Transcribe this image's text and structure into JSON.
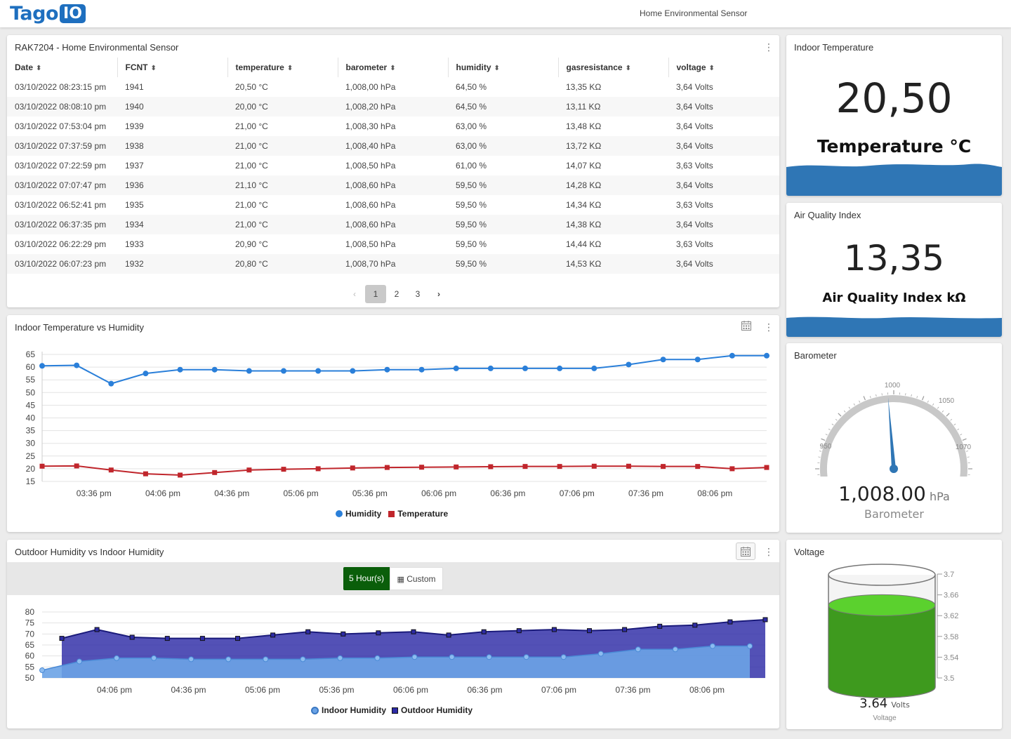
{
  "header": {
    "logo_text": "Tago",
    "logo_box": "IO",
    "dashboard_title": "Home Environmental Sensor",
    "brand_color": "#1e6fbf"
  },
  "table_widget": {
    "title": "RAK7204 - Home Environmental Sensor",
    "columns": [
      "Date",
      "FCNT",
      "temperature",
      "barometer",
      "humidity",
      "gasresistance",
      "voltage"
    ],
    "rows": [
      [
        "03/10/2022 08:23:15 pm",
        "1941",
        "20,50 °C",
        "1,008,00 hPa",
        "64,50 %",
        "13,35 KΩ",
        "3,64 Volts"
      ],
      [
        "03/10/2022 08:08:10 pm",
        "1940",
        "20,00 °C",
        "1,008,20 hPa",
        "64,50 %",
        "13,11 KΩ",
        "3,64 Volts"
      ],
      [
        "03/10/2022 07:53:04 pm",
        "1939",
        "21,00 °C",
        "1,008,30 hPa",
        "63,00 %",
        "13,48 KΩ",
        "3,64 Volts"
      ],
      [
        "03/10/2022 07:37:59 pm",
        "1938",
        "21,00 °C",
        "1,008,40 hPa",
        "63,00 %",
        "13,72 KΩ",
        "3,64 Volts"
      ],
      [
        "03/10/2022 07:22:59 pm",
        "1937",
        "21,00 °C",
        "1,008,50 hPa",
        "61,00 %",
        "14,07 KΩ",
        "3,63 Volts"
      ],
      [
        "03/10/2022 07:07:47 pm",
        "1936",
        "21,10 °C",
        "1,008,60 hPa",
        "59,50 %",
        "14,28 KΩ",
        "3,64 Volts"
      ],
      [
        "03/10/2022 06:52:41 pm",
        "1935",
        "21,00 °C",
        "1,008,60 hPa",
        "59,50 %",
        "14,34 KΩ",
        "3,63 Volts"
      ],
      [
        "03/10/2022 06:37:35 pm",
        "1934",
        "21,00 °C",
        "1,008,60 hPa",
        "59,50 %",
        "14,38 KΩ",
        "3,64 Volts"
      ],
      [
        "03/10/2022 06:22:29 pm",
        "1933",
        "20,90 °C",
        "1,008,50 hPa",
        "59,50 %",
        "14,44 KΩ",
        "3,63 Volts"
      ],
      [
        "03/10/2022 06:07:23 pm",
        "1932",
        "20,80 °C",
        "1,008,70 hPa",
        "59,50 %",
        "14,53 KΩ",
        "3,64 Volts"
      ]
    ],
    "pagination": {
      "prev": "‹",
      "pages": [
        "1",
        "2",
        "3"
      ],
      "active": "1",
      "next": "›"
    }
  },
  "indoor_temp": {
    "title": "Indoor Temperature",
    "value": "20,50",
    "label": "Temperature °C",
    "wave_color": "#2f76b5"
  },
  "air_quality": {
    "title": "Air Quality Index",
    "value": "13,35",
    "label": "Air Quality Index kΩ",
    "wave_color": "#2f76b5"
  },
  "barometer": {
    "title": "Barometer",
    "gauge_labels": [
      "950",
      "1000",
      "1050",
      "1070"
    ],
    "value_text": "1,008.00",
    "unit": "hPa",
    "caption": "Barometer",
    "needle_color": "#2f76b5",
    "alert_color": "#c9302c"
  },
  "voltage": {
    "title": "Voltage",
    "scale_labels": [
      "3.7",
      "3.66",
      "3.62",
      "3.58",
      "3.54",
      "3.5"
    ],
    "value_text": "3.64",
    "unit": "Volts",
    "caption": "Voltage",
    "fill_color": "#3e9a1e",
    "level": 3.64
  },
  "charts": {
    "temp_humidity_title": "Indoor Temperature vs Humidity",
    "outdoor_indoor_title": "Outdoor Humidity vs Indoor Humidity",
    "range_button": "5 Hour(s)",
    "custom_button": "Custom"
  },
  "chart_data": [
    {
      "type": "line",
      "title": "Indoor Temperature vs Humidity",
      "ylim": [
        15,
        65
      ],
      "yticks": [
        15,
        20,
        25,
        30,
        35,
        40,
        45,
        50,
        55,
        60,
        65
      ],
      "xticks": [
        "03:36 pm",
        "04:06 pm",
        "04:36 pm",
        "05:06 pm",
        "05:36 pm",
        "06:06 pm",
        "06:36 pm",
        "07:06 pm",
        "07:36 pm",
        "08:06 pm"
      ],
      "series": [
        {
          "name": "Humidity",
          "color": "#2a7fd9",
          "values": [
            60.5,
            60.7,
            53.5,
            57.5,
            59,
            59,
            58.5,
            58.5,
            58.5,
            58.5,
            59,
            59,
            59.5,
            59.5,
            59.5,
            59.5,
            59.5,
            61,
            63,
            63,
            64.5,
            64.5
          ]
        },
        {
          "name": "Temperature",
          "color": "#c0262c",
          "values": [
            21,
            21.1,
            19.5,
            18,
            17.5,
            18.5,
            19.5,
            19.8,
            20,
            20.3,
            20.5,
            20.6,
            20.7,
            20.8,
            20.9,
            20.9,
            21,
            21,
            20.9,
            20.9,
            20,
            20.5
          ]
        }
      ]
    },
    {
      "type": "area",
      "title": "Outdoor Humidity vs Indoor Humidity",
      "ylim": [
        50,
        80
      ],
      "yticks": [
        50,
        55,
        60,
        65,
        70,
        75,
        80
      ],
      "xticks": [
        "04:06 pm",
        "04:36 pm",
        "05:06 pm",
        "05:36 pm",
        "06:06 pm",
        "06:36 pm",
        "07:06 pm",
        "07:36 pm",
        "08:06 pm"
      ],
      "series": [
        {
          "name": "Indoor Humidity",
          "color": "#6ba3e6",
          "values": [
            53.5,
            57.5,
            59,
            59,
            58.5,
            58.5,
            58.5,
            58.5,
            59,
            59,
            59.5,
            59.5,
            59.5,
            59.5,
            59.5,
            61,
            63,
            63,
            64.5,
            64.5
          ]
        },
        {
          "name": "Outdoor Humidity",
          "color": "#2d2ba6",
          "values": [
            68,
            72,
            68.5,
            68,
            68,
            68,
            69.5,
            71,
            70,
            70.5,
            71,
            69.5,
            71,
            71.5,
            72,
            71.5,
            72,
            73.5,
            74,
            75.5,
            76.5
          ]
        }
      ]
    }
  ]
}
